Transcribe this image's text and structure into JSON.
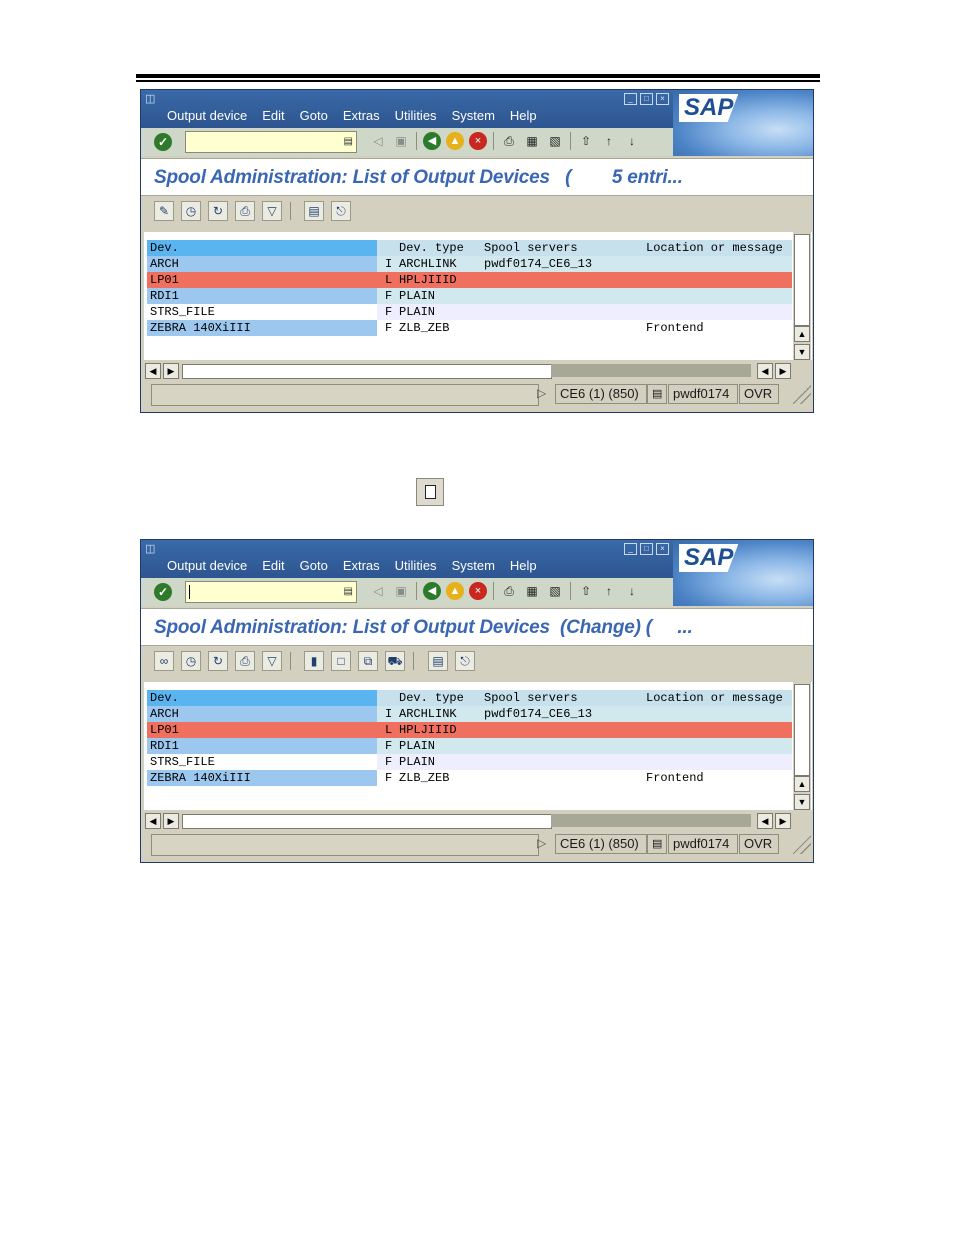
{
  "screens": [
    {
      "menu": [
        "Output device",
        "Edit",
        "Goto",
        "Extras",
        "Utilities",
        "System",
        "Help"
      ],
      "title": "Spool Administration: List of Output Devices   (        5 entri...",
      "logo": "SAP",
      "table": {
        "headers": {
          "dev": "Dev.",
          "type": "Dev. type",
          "spool": "Spool servers",
          "loc": "Location or message"
        },
        "rows": [
          {
            "dev": "ARCH",
            "flag": "I",
            "type": "ARCHLINK",
            "spool": "pwdf0174_CE6_13",
            "loc": ""
          },
          {
            "dev": "LP01",
            "flag": "L",
            "type": "HPLJIIID",
            "spool": "",
            "loc": ""
          },
          {
            "dev": "RDI1",
            "flag": "F",
            "type": "PLAIN",
            "spool": "",
            "loc": ""
          },
          {
            "dev": "STRS_FILE",
            "flag": "F",
            "type": "PLAIN",
            "spool": "",
            "loc": ""
          },
          {
            "dev": "ZEBRA 140XiIII",
            "flag": "F",
            "type": "ZLB_ZEB",
            "spool": "",
            "loc": "Frontend"
          }
        ]
      },
      "status": {
        "system": "CE6 (1) (850)",
        "server": "pwdf0174",
        "mode": "OVR"
      }
    },
    {
      "menu": [
        "Output device",
        "Edit",
        "Goto",
        "Extras",
        "Utilities",
        "System",
        "Help"
      ],
      "title": "Spool Administration: List of Output Devices  (Change) (     ...",
      "logo": "SAP",
      "table": {
        "headers": {
          "dev": "Dev.",
          "type": "Dev. type",
          "spool": "Spool servers",
          "loc": "Location or message"
        },
        "rows": [
          {
            "dev": "ARCH",
            "flag": "I",
            "type": "ARCHLINK",
            "spool": "pwdf0174_CE6_13",
            "loc": ""
          },
          {
            "dev": "LP01",
            "flag": "L",
            "type": "HPLJIIID",
            "spool": "",
            "loc": ""
          },
          {
            "dev": "RDI1",
            "flag": "F",
            "type": "PLAIN",
            "spool": "",
            "loc": ""
          },
          {
            "dev": "STRS_FILE",
            "flag": "F",
            "type": "PLAIN",
            "spool": "",
            "loc": ""
          },
          {
            "dev": "ZEBRA 140XiIII",
            "flag": "F",
            "type": "ZLB_ZEB",
            "spool": "",
            "loc": "Frontend"
          }
        ]
      },
      "status": {
        "system": "CE6 (1) (850)",
        "server": "pwdf0174",
        "mode": "OVR"
      }
    }
  ],
  "icons": {
    "ok": "enter-checkmark-icon",
    "create": "create-document-icon",
    "colors": {
      "title_blue": "#3a66b4",
      "header_blue": "#5ab4f0",
      "highlight_red": "#f07060"
    }
  }
}
